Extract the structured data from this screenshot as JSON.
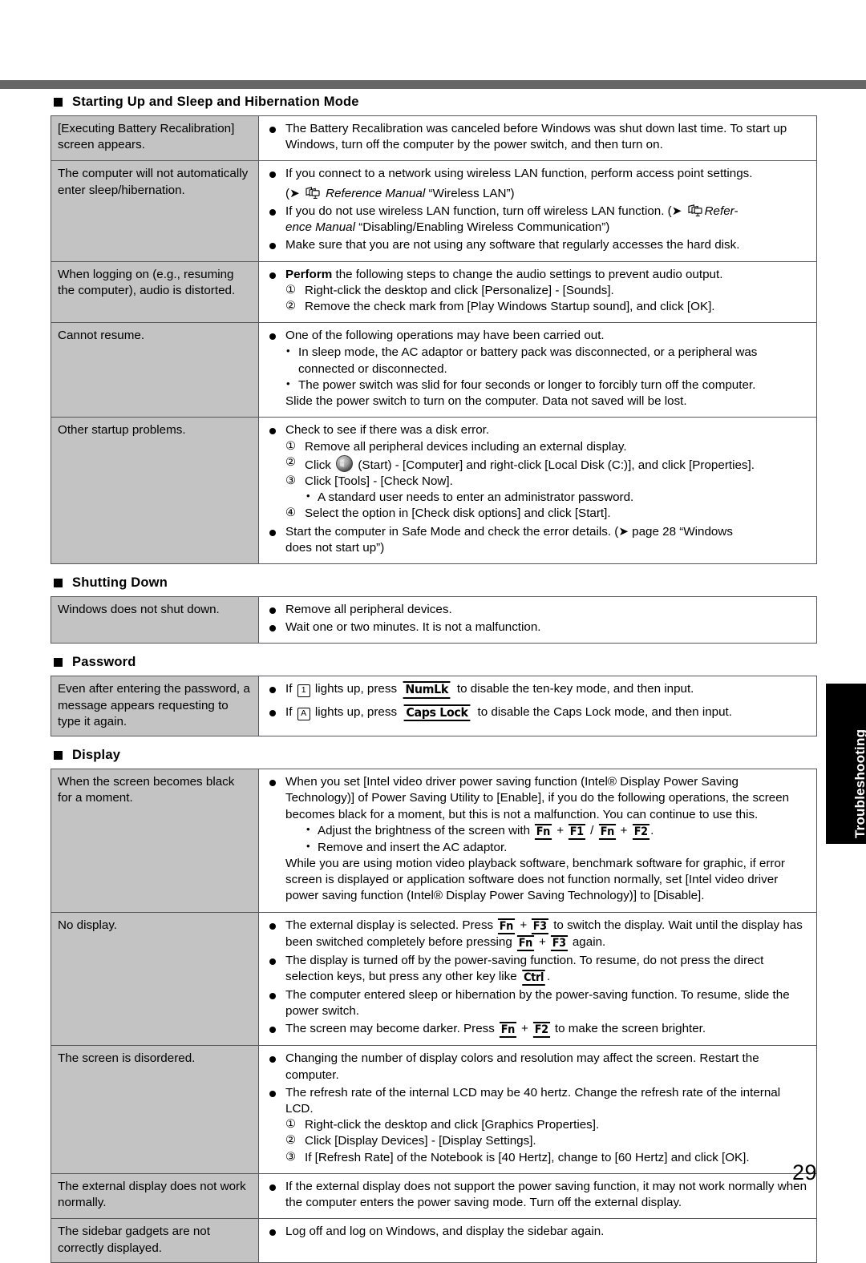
{
  "page": {
    "number": "29",
    "side_tab": "Troubleshooting"
  },
  "sections": [
    {
      "id": "startup",
      "heading": "Starting Up and Sleep and Hibernation Mode",
      "rows": [
        {
          "symptom": "[Executing Battery Recalibration] screen appears.",
          "solution_text": "The Battery Recalibration was canceled before Windows was shut down last time. To start up Windows, turn off the computer by the power switch, and then turn on."
        },
        {
          "symptom": "The computer will not automatically enter sleep/hibernation.",
          "b1": "If you connect to a network using wireless LAN function, perform access point settings.",
          "b1_ref_open": "(",
          "b1_ref_manual": "Reference Manual",
          "b1_ref_title": "“Wireless LAN”)",
          "b2_a": "If you do not use wireless LAN function, turn off wireless LAN function. (",
          "b2_manual_a": "Refer-",
          "b2_manual_b": "ence Manual",
          "b2_title": "“Disabling/Enabling Wireless Communication”)",
          "b3": "Make sure that you are not using any software that regularly accesses the hard disk."
        },
        {
          "symptom": "When logging on (e.g., resuming the computer), audio is distorted.",
          "lead_bold": "Perform",
          "lead_rest": " the following steps to change the audio settings to prevent audio output.",
          "step1": "Right-click the desktop and click [Personalize] - [Sounds].",
          "step2": "Remove the check mark from [Play Windows Startup sound], and click [OK].",
          "n1": "①",
          "n2": "②"
        },
        {
          "symptom": "Cannot resume.",
          "lead": "One of the following operations may have been carried out.",
          "sub1": "In sleep mode, the AC adaptor or battery pack was disconnected, or a peripheral was connected or disconnected.",
          "sub2": "The power switch was slid for four seconds or longer to forcibly turn off the computer.",
          "sub2_cont": "Slide the power switch to turn on the computer. Data not saved will be lost."
        },
        {
          "symptom": "Other startup problems.",
          "lead": "Check to see if there was a disk error.",
          "n1": "①",
          "n2": "②",
          "n3": "③",
          "n4": "④",
          "step1": "Remove all peripheral devices including an external display.",
          "step2_a": "Click",
          "step2_b": "(Start) - [Computer] and right-click [Local Disk (C:)], and click [Properties].",
          "step3": "Click [Tools] - [Check Now].",
          "step3_sub": "A standard user needs to enter an administrator password.",
          "step4": "Select the option in [Check disk options] and click [Start].",
          "last_a": "Start the computer in Safe Mode and check the error details. (",
          "last_b": " page 28 “Windows",
          "last_c": "does not start up”)"
        }
      ]
    },
    {
      "id": "shutdown",
      "heading": "Shutting Down",
      "rows": [
        {
          "symptom": "Windows does not shut down.",
          "b1": "Remove all peripheral devices.",
          "b2": "Wait one or two minutes. It is not a malfunction."
        }
      ]
    },
    {
      "id": "password",
      "heading": "Password",
      "rows": [
        {
          "symptom": "Even after entering the password, a message appears requesting to type it again.",
          "b1_pre": "If",
          "b1_led": "1",
          "b1_mid": "lights up, press",
          "b1_key": "NumLk",
          "b1_post": "to disable the ten-key mode, and then input.",
          "b2_pre": "If",
          "b2_led": "A",
          "b2_mid": "lights up, press",
          "b2_key": "Caps Lock",
          "b2_post": "to disable the Caps Lock mode, and then input."
        }
      ]
    },
    {
      "id": "display",
      "heading": "Display",
      "rows": [
        {
          "symptom": "When the screen becomes black for a moment.",
          "p1": "When you set [Intel video driver power saving function (Intel® Display Power Saving Technology)] of Power Saving Utility to [Enable], if you do the following operations, the screen becomes black for a moment, but this is not a malfunction. You can continue to use this.",
          "sub1_pre": "Adjust the brightness of the screen with",
          "k_fn": "Fn",
          "k_f1": "F1",
          "k_f2": "F2",
          "k_f3": "F3",
          "k_ctrl": "Ctrl",
          "sub2": "Remove and insert the AC adaptor.",
          "p2": "While you are using motion video playback software, benchmark software for graphic, if error screen is displayed or application software does not function normally, set [Intel video driver power saving function (Intel® Display Power Saving Technology)] to [Disable]."
        },
        {
          "symptom": "No display.",
          "b1_a": "The external display is selected. Press",
          "b1_b": "to switch the display. Wait until the display has been switched completely before pressing",
          "b1_c": "again.",
          "b2_a": "The display is turned off by the power-saving function. To resume, do not press the direct selection keys, but press any other key like",
          "b2_b": ".",
          "b3": "The computer entered sleep or hibernation by the power-saving function. To resume, slide the power switch.",
          "b4_a": "The screen may become darker. Press",
          "b4_b": "to make the screen brighter."
        },
        {
          "symptom": "The screen is disordered.",
          "b1": "Changing the number of display colors and resolution may affect the screen. Restart the computer.",
          "b2": "The refresh rate of the internal LCD may be 40 hertz. Change the refresh rate of the internal LCD.",
          "n1": "①",
          "n2": "②",
          "n3": "③",
          "step1": "Right-click the desktop and click [Graphics Properties].",
          "step2": "Click [Display Devices] - [Display Settings].",
          "step3": "If [Refresh Rate] of the Notebook is [40 Hertz], change to [60 Hertz] and click [OK]."
        },
        {
          "symptom": "The external display does not work normally.",
          "b1": "If the external display does not support the power saving function, it may not work normally when the computer enters the power saving mode. Turn off the external display."
        },
        {
          "symptom": "The sidebar gadgets are not correctly displayed.",
          "b1": "Log off and log on Windows, and display the sidebar again."
        }
      ]
    }
  ],
  "icons": {
    "arrow": "➔",
    "book": "reference-manual-icon",
    "start_orb": "windows-start-icon"
  }
}
